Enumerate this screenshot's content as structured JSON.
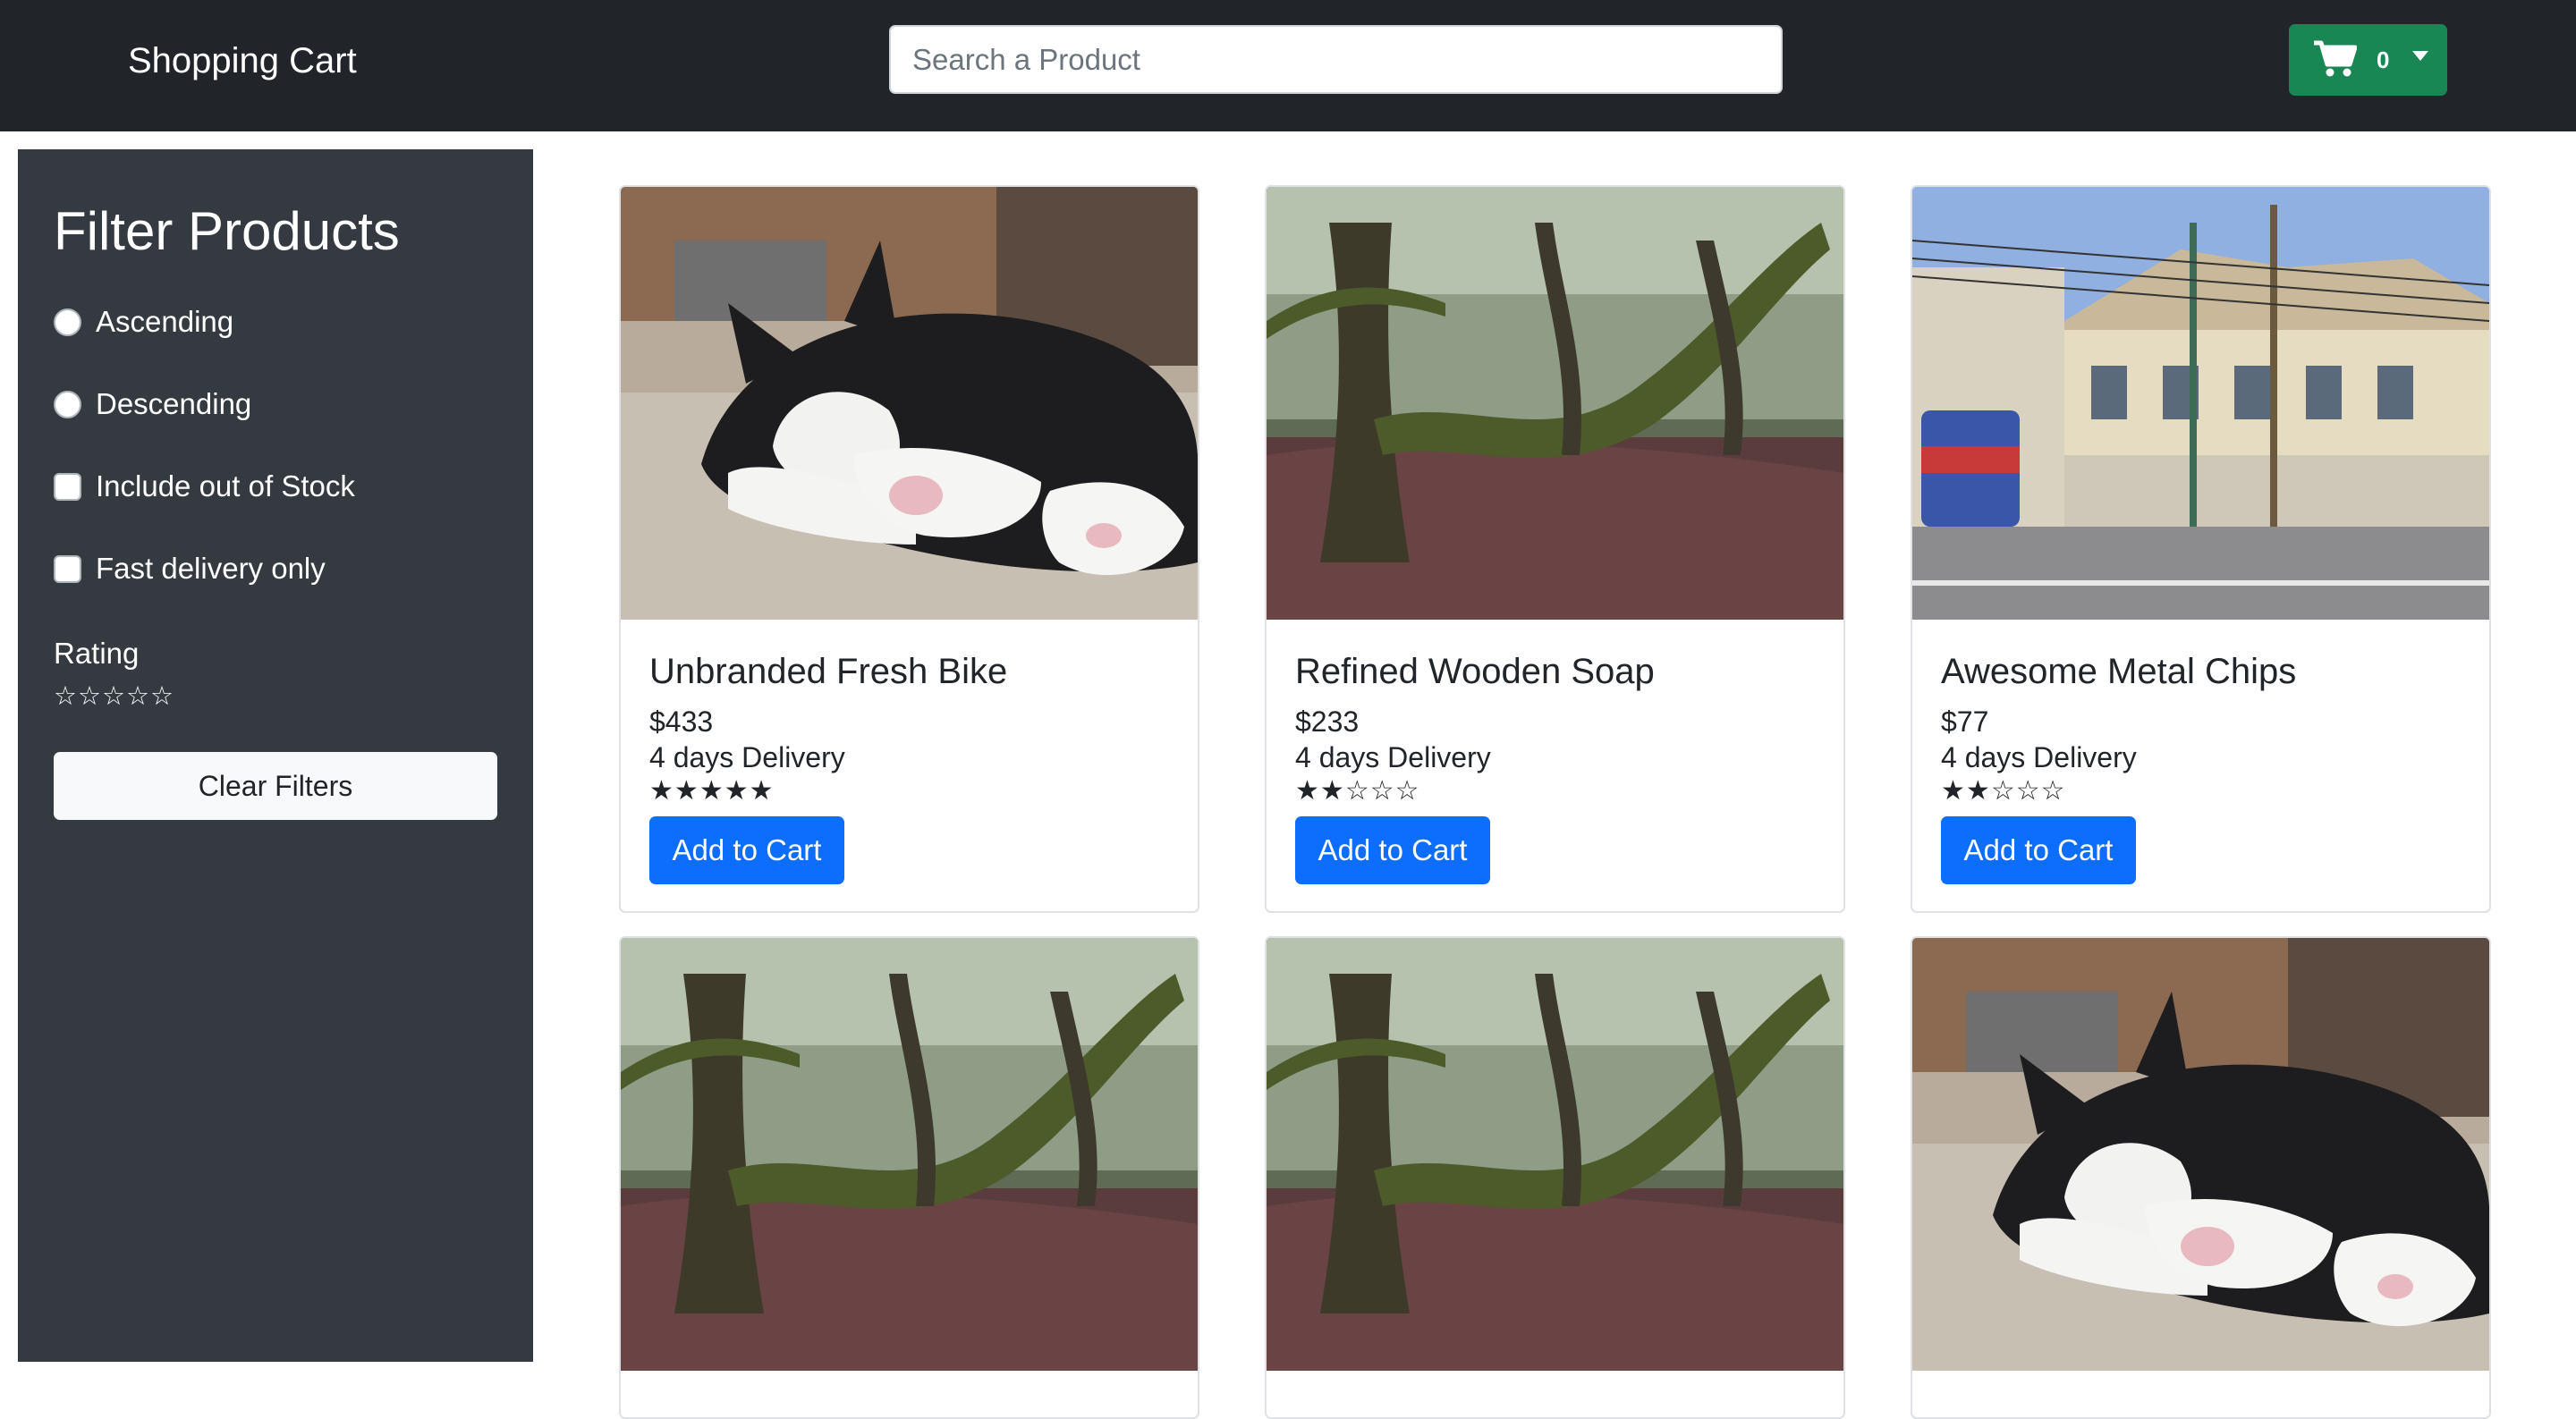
{
  "navbar": {
    "title": "Shopping Cart",
    "search_placeholder": "Search a Product",
    "cart_count": "0",
    "accent": "#198754"
  },
  "sidebar": {
    "title": "Filter Products",
    "options": [
      {
        "type": "radio",
        "label": "Ascending"
      },
      {
        "type": "radio",
        "label": "Descending"
      },
      {
        "type": "checkbox",
        "label": "Include out of Stock"
      },
      {
        "type": "checkbox",
        "label": "Fast delivery only"
      }
    ],
    "rating_label": "Rating",
    "rating_value": 0,
    "clear_label": "Clear Filters"
  },
  "products": [
    {
      "name": "Unbranded Fresh Bike",
      "price": "$433",
      "delivery": "4 days Delivery",
      "rating": 5,
      "image": "cat",
      "button": "Add to Cart"
    },
    {
      "name": "Refined Wooden Soap",
      "price": "$233",
      "delivery": "4 days Delivery",
      "rating": 2,
      "image": "forest",
      "button": "Add to Cart"
    },
    {
      "name": "Awesome Metal Chips",
      "price": "$77",
      "delivery": "4 days Delivery",
      "rating": 2,
      "image": "street",
      "button": "Add to Cart"
    },
    {
      "image": "forest"
    },
    {
      "image": "forest"
    },
    {
      "image": "cat"
    }
  ]
}
